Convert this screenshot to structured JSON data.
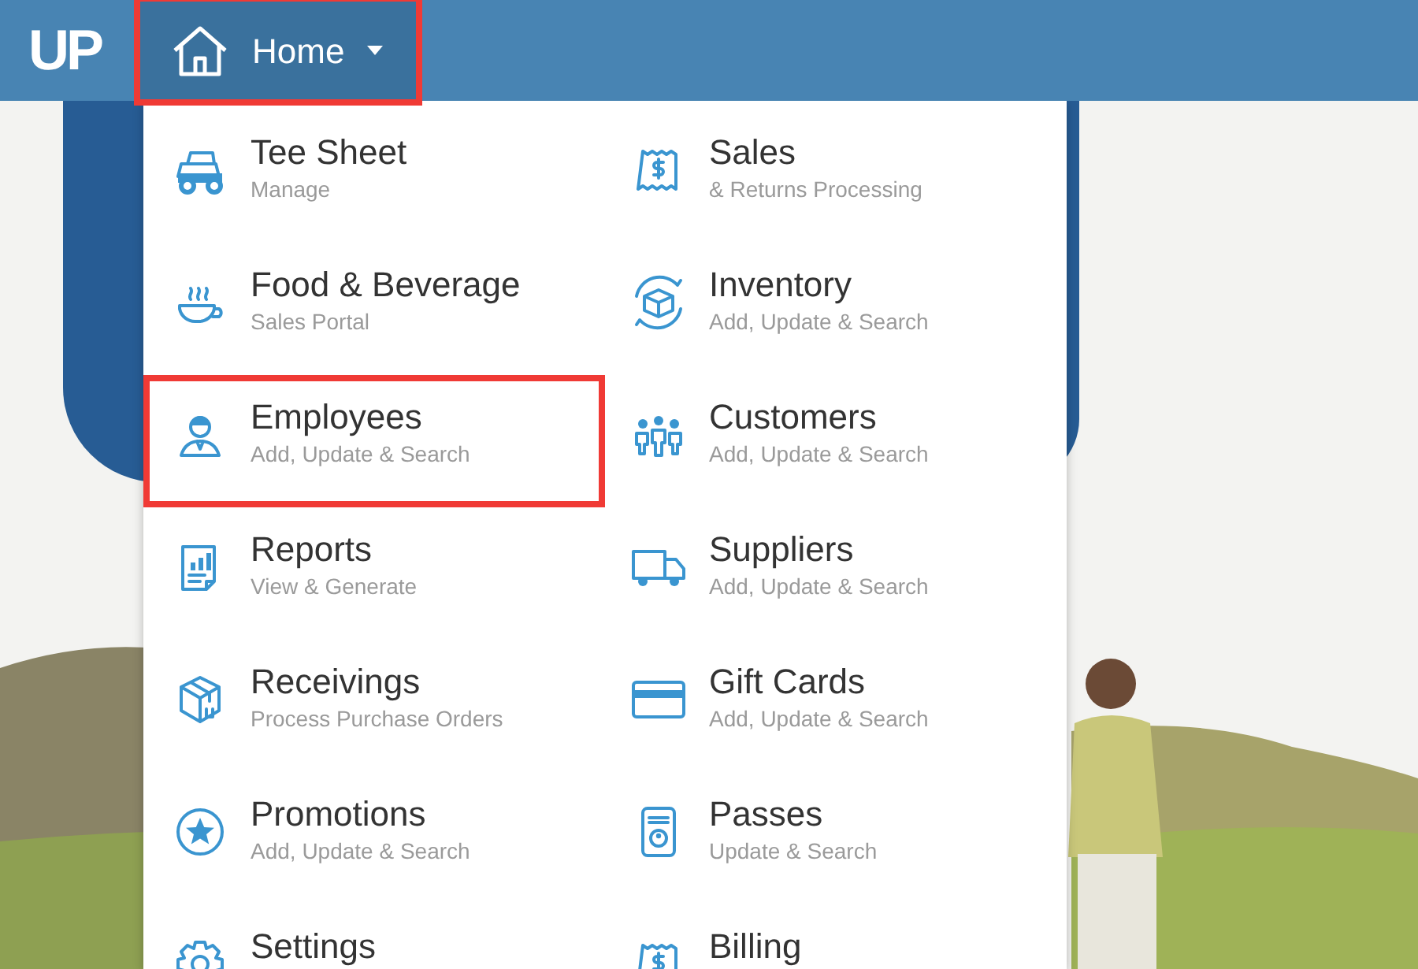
{
  "navbar": {
    "logo": "UP",
    "home_button": {
      "label": "Home",
      "highlighted": true,
      "expanded": true
    }
  },
  "menu": {
    "items": [
      {
        "title": "Tee Sheet",
        "subtitle": "Manage",
        "highlighted": false
      },
      {
        "title": "Sales",
        "subtitle": "& Returns Processing",
        "highlighted": false
      },
      {
        "title": "Food & Beverage",
        "subtitle": "Sales Portal",
        "highlighted": false
      },
      {
        "title": "Inventory",
        "subtitle": "Add, Update & Search",
        "highlighted": false
      },
      {
        "title": "Employees",
        "subtitle": "Add, Update & Search",
        "highlighted": true
      },
      {
        "title": "Customers",
        "subtitle": "Add, Update & Search",
        "highlighted": false
      },
      {
        "title": "Reports",
        "subtitle": "View & Generate",
        "highlighted": false
      },
      {
        "title": "Suppliers",
        "subtitle": "Add, Update & Search",
        "highlighted": false
      },
      {
        "title": "Receivings",
        "subtitle": "Process Purchase Orders",
        "highlighted": false
      },
      {
        "title": "Gift Cards",
        "subtitle": "Add, Update & Search",
        "highlighted": false
      },
      {
        "title": "Promotions",
        "subtitle": "Add, Update & Search",
        "highlighted": false
      },
      {
        "title": "Passes",
        "subtitle": "Update & Search",
        "highlighted": false
      },
      {
        "title": "Settings",
        "highlighted": false
      },
      {
        "title": "Billing",
        "highlighted": false
      }
    ]
  }
}
